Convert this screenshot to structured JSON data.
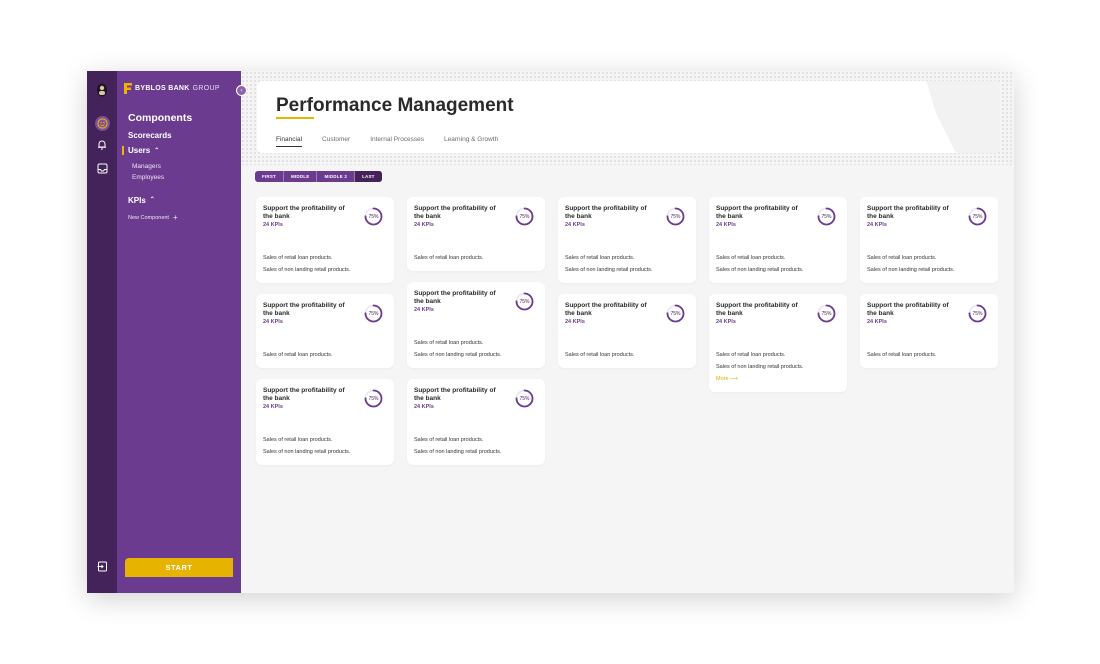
{
  "brand": {
    "name_bold": "BYBLOS BANK",
    "name_light": "GROUP"
  },
  "sidebar": {
    "title": "Components",
    "scorecards": "Scorecards",
    "users": "Users",
    "users_sub": [
      "Managers",
      "Employees"
    ],
    "kpis": "KPIs",
    "new_component": "New Component",
    "start": "START"
  },
  "header": {
    "title": "Performance Management",
    "tabs": [
      "Financial",
      "Customer",
      "Internal Processes",
      "Learning & Growth"
    ],
    "active_tab": "Financial"
  },
  "segments": {
    "items": [
      "FIRST",
      "MIDDLE",
      "MIDDLE 2",
      "LAST"
    ],
    "selected": "LAST"
  },
  "cards": [
    {
      "title": "Support the profitability of the bank",
      "kpis": "24 KPIs",
      "percent": "75%",
      "progress": 0.75,
      "lines": [
        "Sales of retail loan products.",
        "Sales of non landing retail products."
      ]
    },
    {
      "title": "Support the profitability of the bank",
      "kpis": "24 KPIs",
      "percent": "75%",
      "progress": 0.75,
      "lines": [
        "Sales of retail loan products."
      ]
    },
    {
      "title": "Support the profitability of the bank",
      "kpis": "24 KPIs",
      "percent": "75%",
      "progress": 0.75,
      "lines": [
        "Sales of retail loan products.",
        "Sales of non landing retail products."
      ]
    },
    {
      "title": "Support the profitability of the bank",
      "kpis": "24 KPIs",
      "percent": "75%",
      "progress": 0.75,
      "lines": [
        "Sales of retail loan products.",
        "Sales of non landing retail products."
      ]
    },
    {
      "title": "Support the profitability of the bank",
      "kpis": "24 KPIs",
      "percent": "75%",
      "progress": 0.75,
      "lines": [
        "Sales of retail loan products.",
        "Sales of non landing retail products."
      ]
    },
    {
      "title": "Support the profitability of the bank",
      "kpis": "24 KPIs",
      "percent": "75%",
      "progress": 0.75,
      "lines": [
        "Sales of retail loan products."
      ]
    },
    {
      "title": "Support the profitability of the bank",
      "kpis": "24 KPIs",
      "percent": "75%",
      "progress": 0.75,
      "lines": [
        "Sales of retail loan products.",
        "Sales of non landing retail products."
      ]
    },
    {
      "title": "Support the profitability of the bank",
      "kpis": "24 KPIs",
      "percent": "75%",
      "progress": 0.75,
      "lines": [
        "Sales of retail loan products."
      ]
    },
    {
      "title": "Support the profitability of the bank",
      "kpis": "24 KPIs",
      "percent": "75%",
      "progress": 0.75,
      "lines": [
        "Sales of retail loan products.",
        "Sales of non landing retail products."
      ],
      "more": "More ⟶"
    },
    {
      "title": "Support the profitability of the bank",
      "kpis": "24 KPIs",
      "percent": "75%",
      "progress": 0.75,
      "lines": [
        "Sales of retail loan products."
      ]
    },
    {
      "title": "Support the profitability of the bank",
      "kpis": "24 KPIs",
      "percent": "75%",
      "progress": 0.75,
      "lines": [
        "Sales of retail loan products.",
        "Sales of non landing retail products."
      ]
    },
    {
      "title": "Support the profitability of the bank",
      "kpis": "24 KPIs",
      "percent": "75%",
      "progress": 0.75,
      "lines": [
        "Sales of retail loan products.",
        "Sales of non landing retail products."
      ]
    }
  ],
  "colors": {
    "rail": "#43235a",
    "sidebar": "#6b3b8f",
    "accent": "#e6b400"
  },
  "icons": [
    "avatar",
    "smiley-icon",
    "bell-icon",
    "inbox-icon",
    "logout-icon",
    "chevron-left-icon",
    "chevron-up-icon",
    "plus-icon",
    "arrow-right-icon"
  ]
}
